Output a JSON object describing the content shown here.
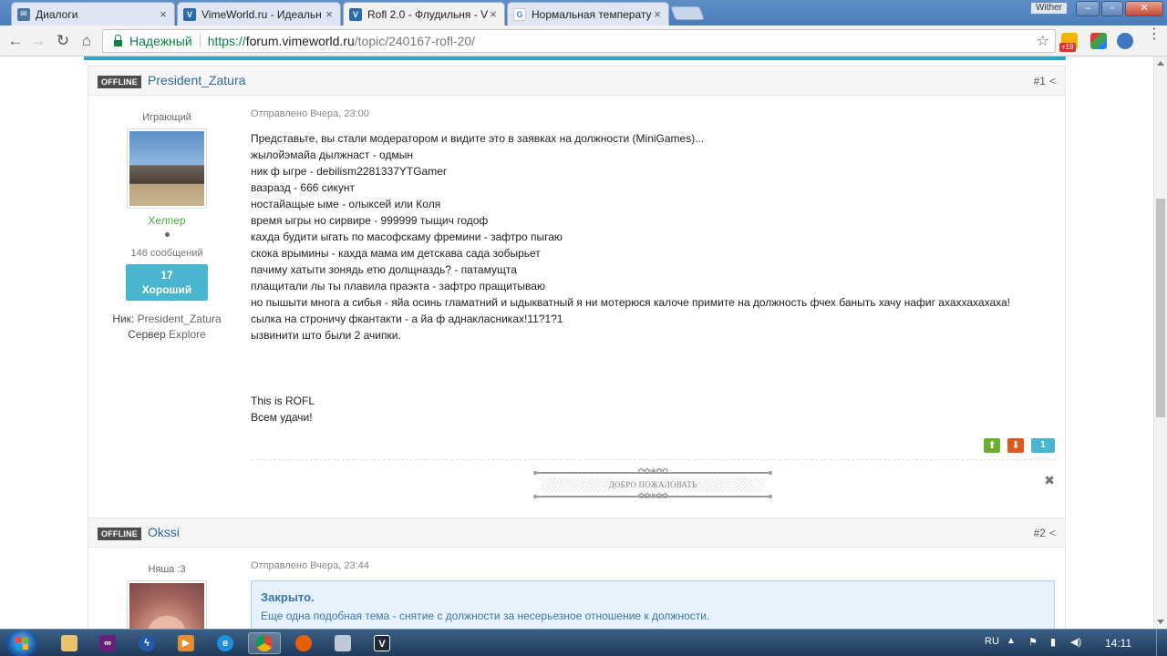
{
  "browser": {
    "tabs": [
      {
        "title": "Диалоги",
        "favicon": "vk-icon",
        "color": "#4a76a8",
        "active": false
      },
      {
        "title": "VimeWorld.ru - Идеальн",
        "favicon": "vimeworld-icon",
        "color": "#2b6cb0",
        "active": false
      },
      {
        "title": "Rofl 2.0 - Флудильня - V",
        "favicon": "vimeworld-icon",
        "color": "#2b6cb0",
        "active": true
      },
      {
        "title": "Нормальная температур",
        "favicon": "google-icon",
        "color": "#4285f4",
        "active": false
      }
    ],
    "window_user": "Wither",
    "secure_label": "Надежный",
    "url_scheme": "https://",
    "url_host": "forum.vimeworld.ru",
    "url_path": "/topic/240167-rofl-20/",
    "ext_badge": "+19"
  },
  "posts": [
    {
      "status": "OFFLINE",
      "author": "President_Zatura",
      "number": "#1",
      "group": "Играющий",
      "role": "Хелпер",
      "messages": "146 сообщений",
      "rep_value": "17",
      "rep_label": "Хороший",
      "nick_label": "Ник:",
      "nick": "President_Zatura",
      "server_label": "Сервер",
      "server": "Explore",
      "posted": "Отправлено Вчера, 23:00",
      "lines": [
        "Представьте, вы стали модератором и видите это в заявках на должности (MiniGames)...",
        "жылойэмайа дылжнаст - одмын",
        "ник ф ыгре - debilism2281337YTGamer",
        "вазразд - 666 сикунт",
        "ностайащые ыме - олыксей или Коля",
        "время ыгры но сирвире - 999999 тыщич годоф",
        "кахда будити ыгать по масофскаму фремини - зафтро пыгаю",
        "скока врымины - кахда мама им детскава сада зобырьет",
        "пачиму хатыти зонядь етю долщназдь? - патамущта",
        "плащитали лы ты плавила праэкта - зафтро пращитываю",
        "но пышыти многа а сибья - яйа осинь гламатний и ыдыкватный я ни мотерюся калоче примите на должность фчех баныть хачу нафиг ахаххахахаха!",
        "сылка на строничу фкантакти - а йа ф аднакласниках!11?1?1",
        "ызвинити што были 2 ачипки.",
        "",
        "",
        "",
        "This is ROFL",
        "Всем удачи!"
      ],
      "vote_count": "1",
      "signature": "ДОБРО ПОЖАЛОВАТЬ"
    },
    {
      "status": "OFFLINE",
      "author": "Okssi",
      "number": "#2",
      "group": "Няша :3",
      "posted": "Отправлено Вчера, 23:44",
      "closed_title": "Закрыто.",
      "closed_text": "Еще одна подобная тема - снятие с должности за несерьезное отношение к должности."
    }
  ],
  "taskbar": {
    "lang": "RU",
    "time": "14:11"
  },
  "colors": {
    "accent": "#30a6c6",
    "author_link": "#2d6b9a",
    "role_green": "#4fab3f",
    "upvote": "#6ab02f",
    "downvote": "#dd5a1f"
  }
}
